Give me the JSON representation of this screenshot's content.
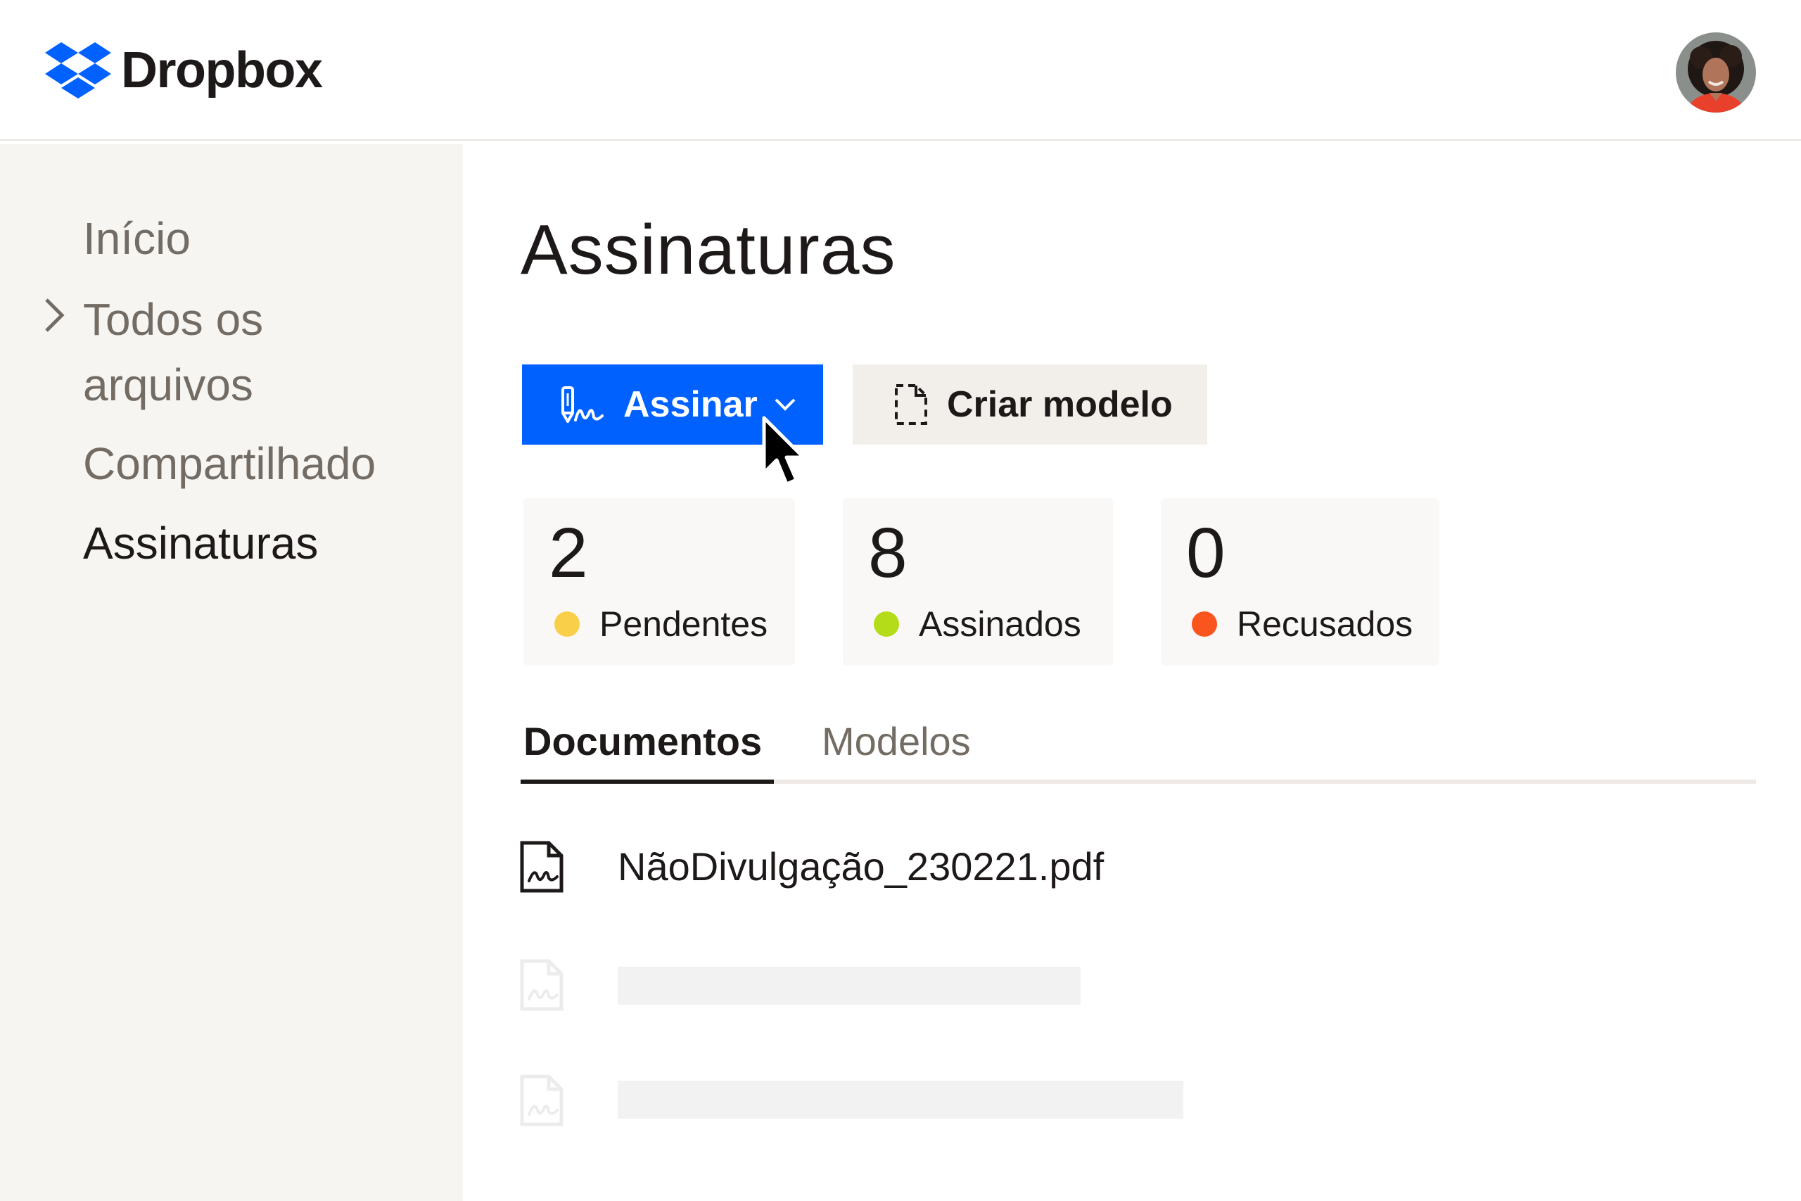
{
  "header": {
    "brand": "Dropbox",
    "brand_color": "#0061fe",
    "logo_icon": "dropbox-logo-icon",
    "avatar_icon": "user-avatar-icon"
  },
  "sidebar": {
    "items": [
      {
        "label": "Início",
        "active": false
      },
      {
        "label": "Todos os",
        "active": false
      },
      {
        "label": "arquivos",
        "active": false
      },
      {
        "label": "Compartilhado",
        "active": false
      },
      {
        "label": "Assinaturas",
        "active": true
      }
    ],
    "chevron_icon": "chevron-right-icon"
  },
  "main": {
    "title": "Assinaturas",
    "primary_button": {
      "label": "Assinar",
      "icon": "signature-pen-icon",
      "caret_icon": "chevron-down-icon",
      "color": "#0061fe"
    },
    "secondary_button": {
      "label": "Criar modelo",
      "icon": "template-document-icon"
    },
    "stats": [
      {
        "count": "2",
        "label": "Pendentes",
        "color": "#f9cf4a"
      },
      {
        "count": "8",
        "label": "Assinados",
        "color": "#b4dc19"
      },
      {
        "count": "0",
        "label": "Recusados",
        "color": "#fa551e"
      }
    ],
    "tabs": [
      {
        "label": "Documentos",
        "active": true
      },
      {
        "label": "Modelos",
        "active": false
      }
    ],
    "documents": [
      {
        "name": "NãoDivulgação_230221.pdf",
        "icon": "signed-document-icon"
      }
    ]
  }
}
